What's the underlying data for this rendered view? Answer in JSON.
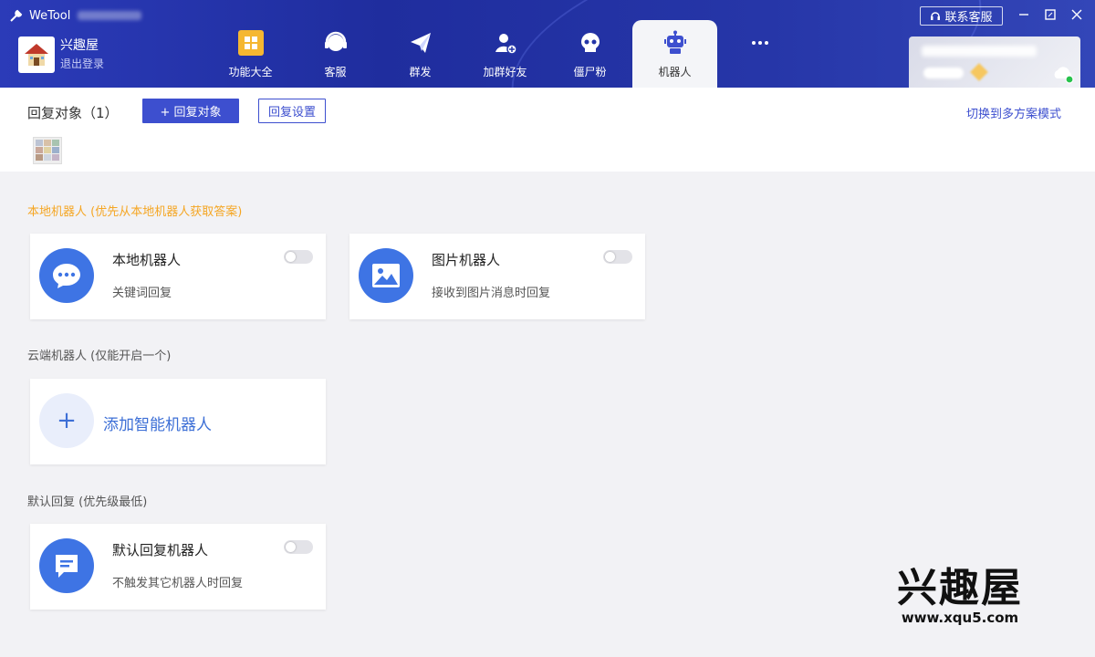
{
  "titlebar": {
    "app_name": "WeTool"
  },
  "header": {
    "contact_label": "联系客服",
    "user": {
      "name": "兴趣屋",
      "logout": "退出登录"
    },
    "nav": [
      {
        "label": "功能大全",
        "icon": "grid-icon"
      },
      {
        "label": "客服",
        "icon": "headset-icon"
      },
      {
        "label": "群发",
        "icon": "paper-plane-icon"
      },
      {
        "label": "加群好友",
        "icon": "add-user-icon"
      },
      {
        "label": "僵尸粉",
        "icon": "skull-icon"
      },
      {
        "label": "机器人",
        "icon": "robot-icon",
        "active": true
      },
      {
        "label": "",
        "icon": "more-icon"
      }
    ]
  },
  "reply_targets": {
    "label": "回复对象（1）",
    "add_button": "+ 回复对象",
    "settings_button": "回复设置",
    "switch_mode": "切换到多方案模式"
  },
  "sections": {
    "local": {
      "title": "本地机器人 (优先从本地机器人获取答案)",
      "cards": [
        {
          "title": "本地机器人",
          "desc": "关键词回复",
          "icon": "chat-bubble-icon",
          "enabled": false
        },
        {
          "title": "图片机器人",
          "desc": "接收到图片消息时回复",
          "icon": "image-icon",
          "enabled": false
        }
      ]
    },
    "cloud": {
      "title": "云端机器人 (仅能开启一个)",
      "add_label": "添加智能机器人"
    },
    "default": {
      "title": "默认回复 (优先级最低)",
      "card": {
        "title": "默认回复机器人",
        "desc": "不触发其它机器人时回复",
        "icon": "message-icon",
        "enabled": false
      }
    }
  },
  "watermark": {
    "main": "兴趣屋",
    "url": "www.xqu5.com"
  },
  "colors": {
    "header": "#2435a8",
    "accent": "#3d4fcf",
    "card_icon": "#3e74e4",
    "local_title": "#f5a623"
  }
}
